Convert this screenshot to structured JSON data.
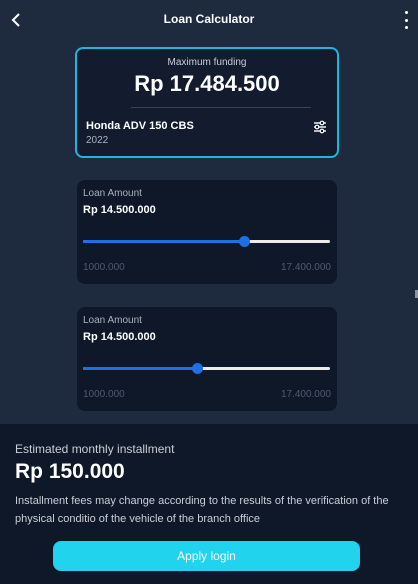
{
  "header": {
    "title": "Loan Calculator",
    "back_icon": "chevron-left-icon",
    "menu_icon": "more-vertical-icon"
  },
  "funding": {
    "label": "Maximum funding",
    "value": "Rp 17.484.500",
    "vehicle_name": "Honda ADV 150 CBS",
    "vehicle_year": "2022",
    "settings_icon": "sliders-icon"
  },
  "loans": [
    {
      "label": "Loan Amount",
      "value": "Rp 14.500.000",
      "min_label": "1000.000",
      "max_label": "17.400.000",
      "slider_fraction": 0.65
    },
    {
      "label": "Loan Amount",
      "value": "Rp 14.500.000",
      "min_label": "1000.000",
      "max_label": "17.400.000",
      "slider_fraction": 0.46
    }
  ],
  "installment": {
    "label": "Estimated monthly installment",
    "value": "Rp 150.000",
    "note": "Installment fees may change according to the results of the verification of the physical conditio of the vehicle of the branch office"
  },
  "actions": {
    "apply_label": "Apply login"
  },
  "colors": {
    "background": "#1e2a3d",
    "card": "#0f1828",
    "accent": "#22d3ee",
    "slider": "#1f6fe5"
  }
}
